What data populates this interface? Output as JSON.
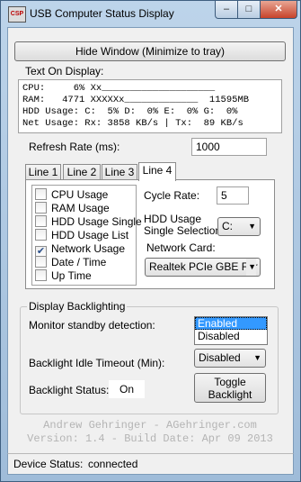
{
  "window": {
    "title": "USB Computer Status Display",
    "icon_text": "CSP",
    "min_glyph": "–",
    "max_glyph": "□",
    "close_glyph": "✕"
  },
  "hide_button": "Hide Window (Minimize to tray)",
  "display": {
    "label": "Text On Display:",
    "lines": [
      "CPU:     6% Xx____________________",
      "RAM:   4771 XXXXXx_____________  11595MB",
      "HDD Usage: C:  5% D:  0% E:  0% G:  0%",
      "Net Usage: Rx: 3858 KB/s | Tx:  89 KB/s"
    ]
  },
  "refresh": {
    "label": "Refresh Rate (ms):",
    "value": "1000"
  },
  "tabs": [
    "Line 1",
    "Line 2",
    "Line 3",
    "Line 4"
  ],
  "active_tab": "Line 4",
  "line4": {
    "items": [
      {
        "label": "CPU Usage",
        "checked": false
      },
      {
        "label": "RAM Usage",
        "checked": false
      },
      {
        "label": "HDD Usage Single",
        "checked": false
      },
      {
        "label": "HDD Usage List",
        "checked": false
      },
      {
        "label": "Network Usage",
        "checked": true
      },
      {
        "label": "Date / Time",
        "checked": false
      },
      {
        "label": "Up Time",
        "checked": false
      }
    ],
    "cycle_rate_label": "Cycle Rate:",
    "cycle_rate_value": "5",
    "hdd_label_1": "HDD Usage",
    "hdd_label_2": "Single Selection:",
    "hdd_value": "C:",
    "network_label": "Network Card:",
    "network_value": "Realtek PCIe GBE Far"
  },
  "backlight": {
    "group_label": "Display Backlighting",
    "standby_label": "Monitor standby detection:",
    "standby_options": [
      "Enabled",
      "Disabled"
    ],
    "standby_selected": "Enabled",
    "timeout_label": "Backlight Idle Timeout (Min):",
    "timeout_value": "Disabled",
    "status_label": "Backlight Status:",
    "status_value": "On",
    "toggle_line1": "Toggle",
    "toggle_line2": "Backlight"
  },
  "footer": {
    "line1": "Andrew Gehringer - AGehringer.com",
    "line2": "Version: 1.4 - Build Date: Apr 09 2013"
  },
  "status": {
    "label": "Device Status:",
    "value": "connected"
  },
  "colors": {
    "selection": "#3399ff",
    "close_button": "#c7432b",
    "footer_text": "#b4b4b4"
  }
}
